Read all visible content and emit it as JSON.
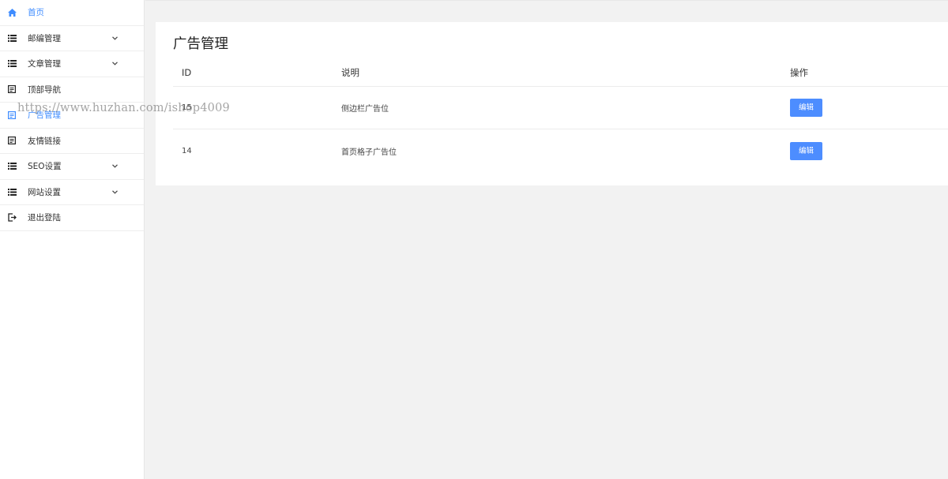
{
  "sidebar": {
    "items": [
      {
        "label": "首页",
        "icon": "home-icon",
        "active": true,
        "expandable": false
      },
      {
        "label": "邮编管理",
        "icon": "list-icon",
        "active": false,
        "expandable": true
      },
      {
        "label": "文章管理",
        "icon": "list-icon",
        "active": false,
        "expandable": true
      },
      {
        "label": "顶部导航",
        "icon": "document-icon",
        "active": false,
        "expandable": false
      },
      {
        "label": "广告管理",
        "icon": "document-icon",
        "active": true,
        "expandable": false
      },
      {
        "label": "友情链接",
        "icon": "document-icon",
        "active": false,
        "expandable": false
      },
      {
        "label": "SEO设置",
        "icon": "list-icon",
        "active": false,
        "expandable": true
      },
      {
        "label": "网站设置",
        "icon": "list-icon",
        "active": false,
        "expandable": true
      },
      {
        "label": "退出登陆",
        "icon": "logout-icon",
        "active": false,
        "expandable": false
      }
    ]
  },
  "watermark": "https://www.huzhan.com/ishop4009",
  "main": {
    "title": "广告管理",
    "table": {
      "headers": {
        "id": "ID",
        "desc": "说明",
        "op": "操作"
      },
      "rows": [
        {
          "id": "15",
          "desc": "侧边栏广告位",
          "action": "编辑"
        },
        {
          "id": "14",
          "desc": "首页格子广告位",
          "action": "编辑"
        }
      ]
    }
  },
  "colors": {
    "accent": "#3f8cff",
    "button": "#4d8dff",
    "background": "#f2f2f2"
  }
}
